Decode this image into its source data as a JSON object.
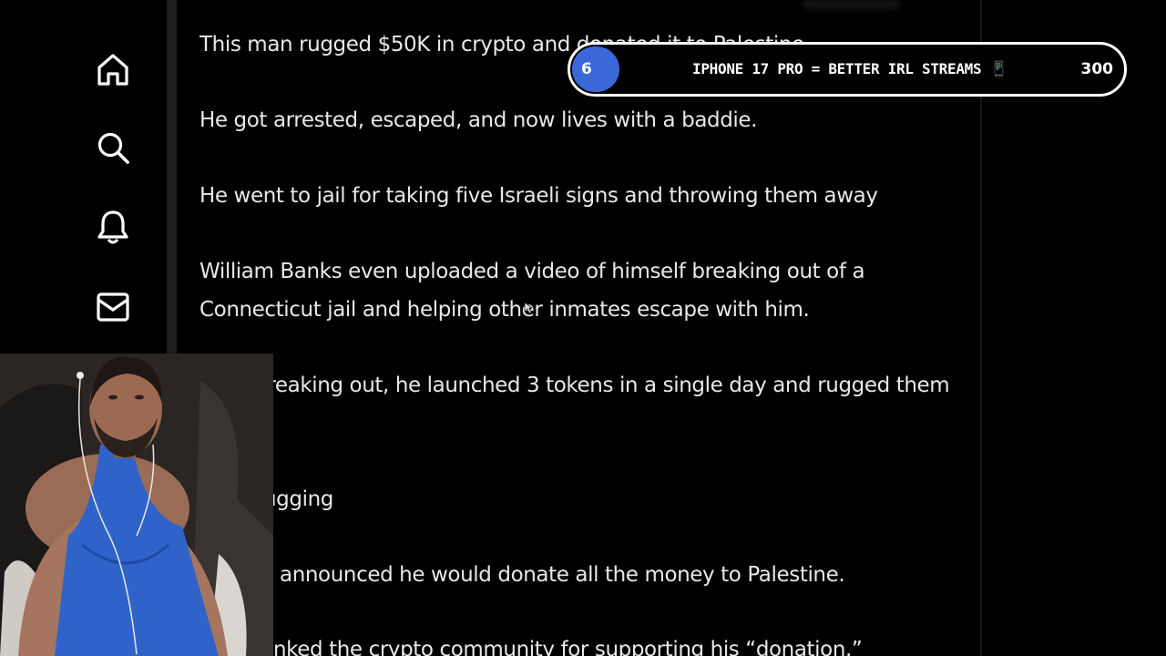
{
  "sidebar": {
    "items": [
      {
        "name": "home",
        "icon": "home-icon"
      },
      {
        "name": "explore",
        "icon": "search-icon"
      },
      {
        "name": "notifications",
        "icon": "bell-icon"
      },
      {
        "name": "messages",
        "icon": "mail-icon"
      }
    ]
  },
  "post": {
    "lines": [
      "This man rugged $50K in crypto and donated it to Palestine.",
      "He got arrested, escaped, and now lives with a baddie.",
      "He went to jail for taking five Israeli signs and throwing them away",
      "William Banks even uploaded a video of himself breaking out of a",
      "Connecticut jail and helping other inmates escape with him.",
      "After breaking out, he launched 3 tokens in a single day and rugged them",
      "ugging",
      "announced he would donate all the money to Palestine.",
      "nked the crypto community for supporting his “donation.”"
    ]
  },
  "goal": {
    "current": "6",
    "title": "IPHONE 17 PRO = BETTER IRL STREAMS 📱",
    "target": "300",
    "progress_fraction": 0.02,
    "accent": "#3b68d8"
  },
  "webcam": {
    "label": "streamer webcam"
  },
  "colors": {
    "background": "#000000",
    "text": "#e8e8e8",
    "goal_fill": "#3b68d8"
  }
}
